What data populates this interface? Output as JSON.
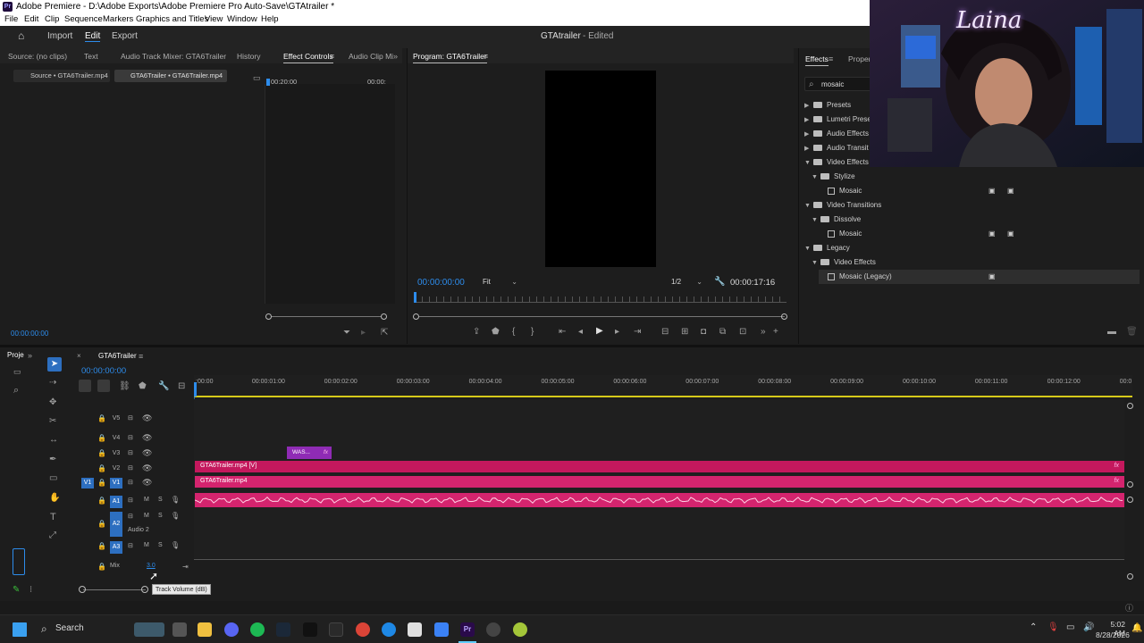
{
  "title": "Adobe Premiere - D:\\Adobe Exports\\Adobe Premiere Pro Auto-Save\\GTAtrailer *",
  "menu": [
    "File",
    "Edit",
    "Clip",
    "Sequence",
    "Markers",
    "Graphics and Titles",
    "View",
    "Window",
    "Help"
  ],
  "workspace": {
    "import": "Import",
    "edit": "Edit",
    "export": "Export",
    "project_title": "GTAtrailer",
    "status": "- Edited"
  },
  "source_panel": {
    "tabs": [
      "Source: (no clips)",
      "Text",
      "Audio Track Mixer: GTA6Trailer",
      "History",
      "Effect Controls",
      "Audio Clip Mi"
    ],
    "subtabs": [
      "Source • GTA6Trailer.mp4",
      "GTA6Trailer • GTA6Trailer.mp4"
    ],
    "time_a": "00:20:00",
    "time_b": "00:00:",
    "timecode": "00:00:00:00"
  },
  "program": {
    "title": "Program: GTA6Trailer",
    "timecode": "00:00:00:00",
    "fit": "Fit",
    "resolution": "1/2",
    "duration": "00:00:17:16"
  },
  "effects": {
    "tab": "Effects",
    "tab2": "Propert",
    "search": "mosaic",
    "tree": [
      {
        "label": "Presets",
        "level": 0,
        "type": "folder",
        "open": false
      },
      {
        "label": "Lumetri Prese",
        "level": 0,
        "type": "folder",
        "open": false
      },
      {
        "label": "Audio Effects",
        "level": 0,
        "type": "folder",
        "open": false
      },
      {
        "label": "Audio Transit",
        "level": 0,
        "type": "folder",
        "open": false
      },
      {
        "label": "Video Effects",
        "level": 0,
        "type": "folder",
        "open": true
      },
      {
        "label": "Stylize",
        "level": 1,
        "type": "folder",
        "open": true
      },
      {
        "label": "Mosaic",
        "level": 2,
        "type": "fx"
      },
      {
        "label": "Video Transitions",
        "level": 0,
        "type": "folder",
        "open": true
      },
      {
        "label": "Dissolve",
        "level": 1,
        "type": "folder",
        "open": true
      },
      {
        "label": "Mosaic",
        "level": 2,
        "type": "fx"
      },
      {
        "label": "Legacy",
        "level": 0,
        "type": "folder",
        "open": true
      },
      {
        "label": "Video Effects",
        "level": 1,
        "type": "folder",
        "open": true
      },
      {
        "label": "Mosaic (Legacy)",
        "level": 2,
        "type": "fx"
      }
    ]
  },
  "project_panel": {
    "tab": "Proje"
  },
  "timeline": {
    "sequence": "GTA6Trailer",
    "timecode": "00:00:00:00",
    "ruler": [
      ":00:00",
      "00:00:01:00",
      "00:00:02:00",
      "00:00:03:00",
      "00:00:04:00",
      "00:00:05:00",
      "00:00:06:00",
      "00:00:07:00",
      "00:00:08:00",
      "00:00:09:00",
      "00:00:10:00",
      "00:00:11:00",
      "00:00:12:00",
      "00:0"
    ],
    "tracks_video": [
      "V5",
      "V4",
      "V3",
      "V2",
      "V1"
    ],
    "tracks_audio": [
      "A1",
      "A2",
      "A3"
    ],
    "audio2_name": "Audio 2",
    "mix_label": "Mix",
    "mix_value": "3.0",
    "tooltip": "Track Volume (dB)",
    "clips": {
      "v3": "WAS...",
      "v2": "GTA6Trailer.mp4 [V]",
      "v1": "GTA6Trailer.mp4"
    }
  },
  "taskbar": {
    "search": "Search",
    "time": "5:02 AM",
    "date": "8/28/2026"
  },
  "webcam_sign": "Laina",
  "colors": {
    "accent": "#2d8ceb",
    "clip_video": "#c4185d",
    "clip_audio": "#d4246e",
    "clip_purple": "#8f2bb5"
  }
}
